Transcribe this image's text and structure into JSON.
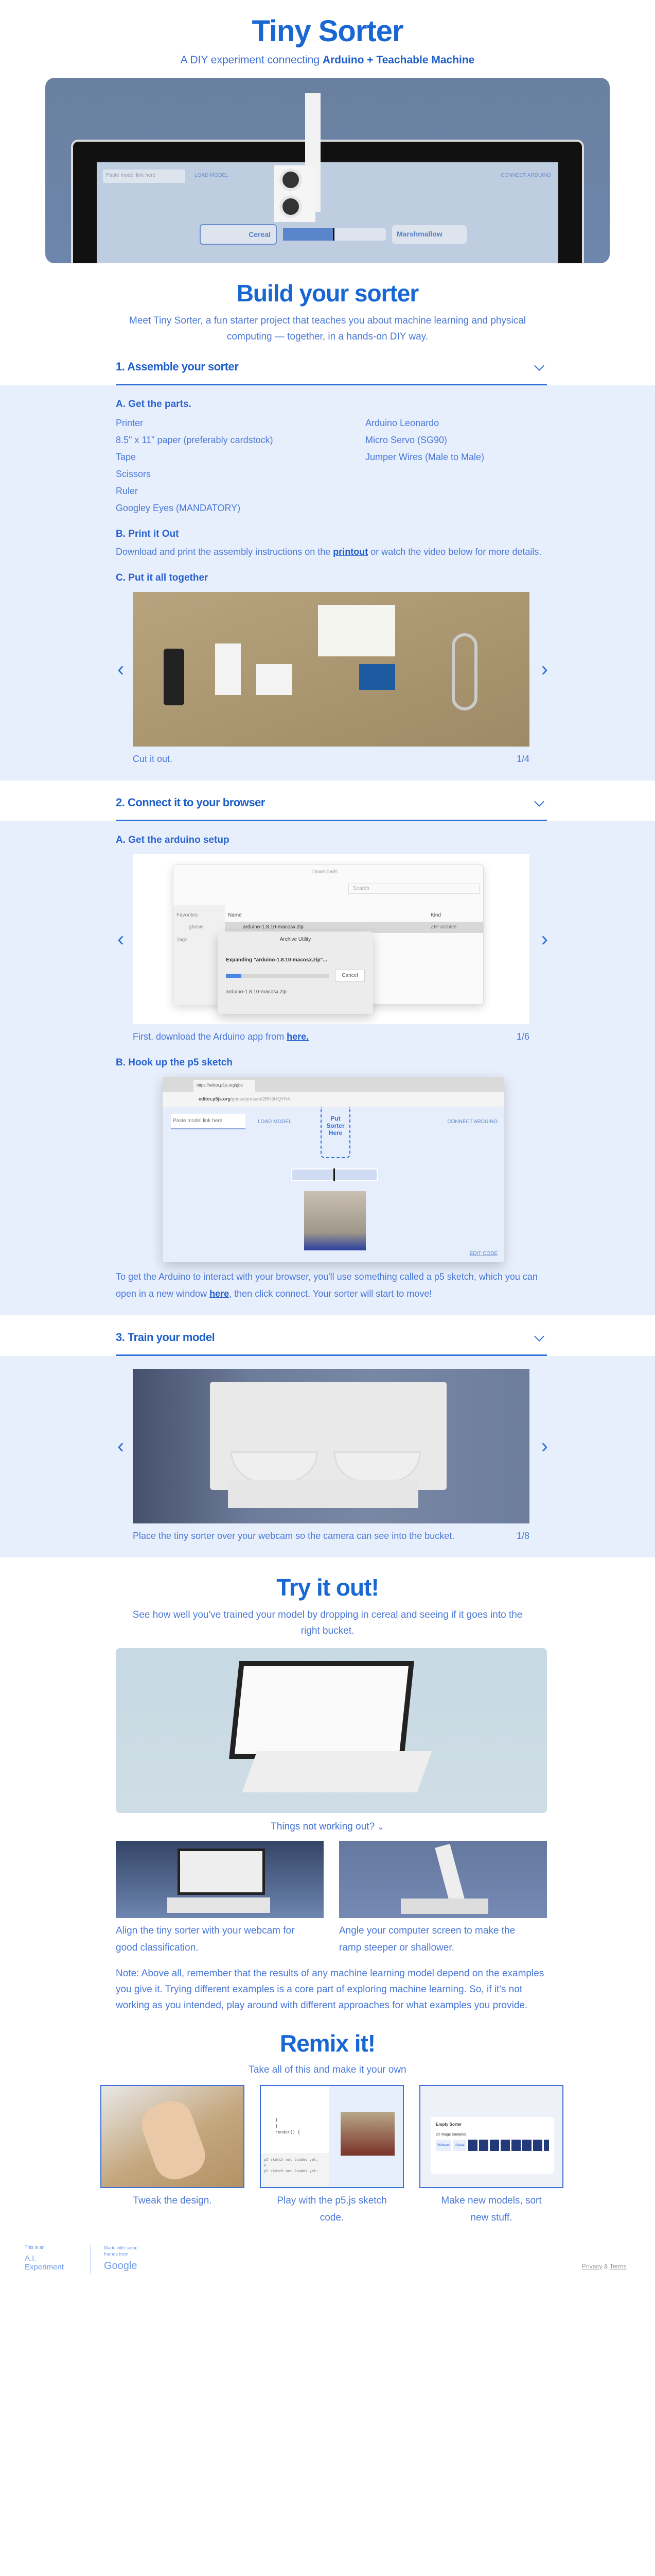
{
  "header": {
    "title": "Tiny Sorter",
    "subtitle_pre": "A DIY experiment connecting ",
    "subtitle_bold": "Arduino + Teachable Machine"
  },
  "hero": {
    "paste": "Paste model link here",
    "load": "LOAD MODEL",
    "connect": "CONNECT ARDUINO",
    "class_a": "Cereal",
    "class_b": "Marshmallow",
    "slider_value": 0.5
  },
  "build": {
    "title": "Build your sorter",
    "description": "Meet Tiny Sorter, a fun starter project that teaches you about machine learning and physical computing — together, in a hands-on DIY way."
  },
  "step1": {
    "title": "1. Assemble your sorter",
    "parts_title": "A. Get the parts.",
    "parts_left": [
      "Printer",
      "8.5\" x 11\" paper (preferably cardstock)",
      "Tape",
      "Scissors",
      "Ruler",
      "Googley Eyes (MANDATORY)"
    ],
    "parts_right": [
      "Arduino Leonardo",
      "Micro Servo (SG90)",
      "Jumper Wires (Male to Male)"
    ],
    "print_title": "B. Print it Out",
    "print_pre": "Download and print the assembly instructions on the ",
    "print_link": "printout",
    "print_post": " or watch the video below for more details.",
    "together_title": "C. Put it all together",
    "carousel": {
      "caption": "Cut it out.",
      "counter": "1/4"
    }
  },
  "step2": {
    "title": "2. Connect it to your browser",
    "a_title": "A. Get the arduino setup",
    "finder": {
      "window": "Downloads",
      "search": "Search",
      "favorites": "Favorites",
      "user": "gbose",
      "tags": "Tags",
      "col_name": "Name",
      "col_kind": "Kind",
      "file": "arduino-1.8.10-macosx.zip",
      "kind": "ZIP archive",
      "dialog_title": "Archive Utility",
      "expanding": "Expanding \"arduino-1.8.10-macosx.zip\"...",
      "cancel": "Cancel",
      "progress": 0.15
    },
    "carousel": {
      "caption_pre": "First, download the Arduino app from ",
      "caption_link": "here.",
      "counter": "1/6"
    },
    "b_title": "B. Hook up the p5 sketch",
    "browser": {
      "tab": "https://editor.p5js.org/gbo",
      "url_bold": "editor.p5js.org",
      "url_rest": "/gbose/present/2BN5HQYNK",
      "paste": "Paste model link here",
      "load": "LOAD MODEL",
      "put": "Put Sorter Here",
      "connect": "CONNECT ARDUINO",
      "edit": "EDIT CODE"
    },
    "b_pre": "To get the Arduino to interact with your browser, you'll use something called a p5 sketch, which you can open in a new window ",
    "b_link": "here",
    "b_post": ", then click connect. Your sorter will start to move!"
  },
  "step3": {
    "title": "3. Train your model",
    "carousel": {
      "caption": "Place the tiny sorter over your webcam so the camera can see into the bucket.",
      "counter": "1/8"
    }
  },
  "try": {
    "title": "Try it out!",
    "description": "See how well you've trained your model by dropping in cereal and seeing if it goes into the right bucket.",
    "toggle": "Things not working out?",
    "tips": [
      "Align the tiny sorter with your webcam for good classification.",
      "Angle your computer screen to make the ramp steeper or shallower."
    ],
    "note": "Note: Above all, remember that the results of any machine learning model depend on the examples you give it. Trying different examples is a core part of exploring machine learning. So, if it's not working as you intended, play around with different approaches for what examples you provide."
  },
  "remix": {
    "title": "Remix it!",
    "description": "Take all of this and make it your own",
    "cards": [
      "Tweak the design.",
      "Play with the p5.js sketch code.",
      "Make new models, sort new stuff."
    ],
    "code_lines": [
      "}",
      "}",
      "render() {",
      "p5 sketch not loaded yet:",
      "0",
      "p5 sketch not loaded yet:"
    ],
    "tm_class": "Empty Sorter",
    "tm_samples": "20 Image Samples",
    "tm_webcam": "Webcam",
    "tm_upload": "Upload"
  },
  "footer": {
    "ai_pre": "This is an",
    "ai_name": "A.I. Experiment",
    "made": "Made with some friends from",
    "google": "Google",
    "privacy": "Privacy",
    "amp": " & ",
    "terms": "Terms"
  },
  "colors": {
    "primary": "#1967d2",
    "band": "#e8effc"
  }
}
